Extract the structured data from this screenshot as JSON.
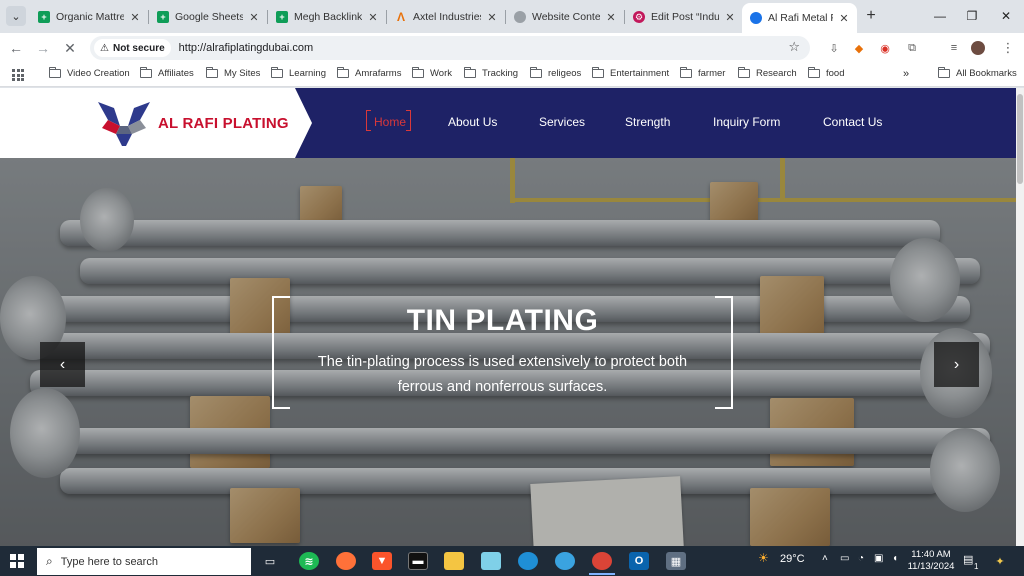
{
  "browser": {
    "tabs": [
      {
        "title": "Organic Mattres",
        "favicon": "sheets-icon",
        "color": "#0f9d58"
      },
      {
        "title": "Google Sheets",
        "favicon": "sheets-icon",
        "color": "#0f9d58"
      },
      {
        "title": "Megh Backlinks",
        "favicon": "sheets-icon",
        "color": "#0f9d58"
      },
      {
        "title": "Axtel Industries",
        "favicon": "axtel-icon",
        "color": "#e8710a"
      },
      {
        "title": "Website Content",
        "favicon": "globe-icon",
        "color": "#5f6368"
      },
      {
        "title": "Edit Post “Indust",
        "favicon": "gear-icon",
        "color": "#c2185b"
      },
      {
        "title": "Al Rafi Metal Pla",
        "favicon": "site-icon",
        "color": "#1a73e8",
        "active": true
      }
    ],
    "security_label": "Not secure",
    "url": "http://alrafiplatingdubai.com",
    "bookmarks": [
      {
        "label": "Video Creation"
      },
      {
        "label": "Affiliates"
      },
      {
        "label": "My Sites"
      },
      {
        "label": "Learning"
      },
      {
        "label": "Amrafarms"
      },
      {
        "label": "Work"
      },
      {
        "label": "Tracking"
      },
      {
        "label": "religeos"
      },
      {
        "label": "Entertainment"
      },
      {
        "label": "farmer"
      },
      {
        "label": "Research"
      },
      {
        "label": "food"
      }
    ],
    "all_bookmarks_label": "All Bookmarks"
  },
  "site": {
    "logo_text": "AL RAFI PLATING",
    "brand_color": "#c8102e",
    "nav_color": "#1e2266",
    "menu": [
      {
        "label": "Home",
        "active": true
      },
      {
        "label": "About Us"
      },
      {
        "label": "Services"
      },
      {
        "label": "Strength"
      },
      {
        "label": "Inquiry Form"
      },
      {
        "label": "Contact Us"
      }
    ],
    "hero": {
      "title": "TIN PLATING",
      "description": "The tin-plating process is used extensively to protect both ferrous and nonferrous surfaces.",
      "prev_icon": "chevron-left-icon",
      "next_icon": "chevron-right-icon"
    }
  },
  "taskbar": {
    "search_placeholder": "Type here to search",
    "weather": "29°C",
    "time": "11:40 AM",
    "date": "11/13/2024",
    "notification_count": "1"
  }
}
